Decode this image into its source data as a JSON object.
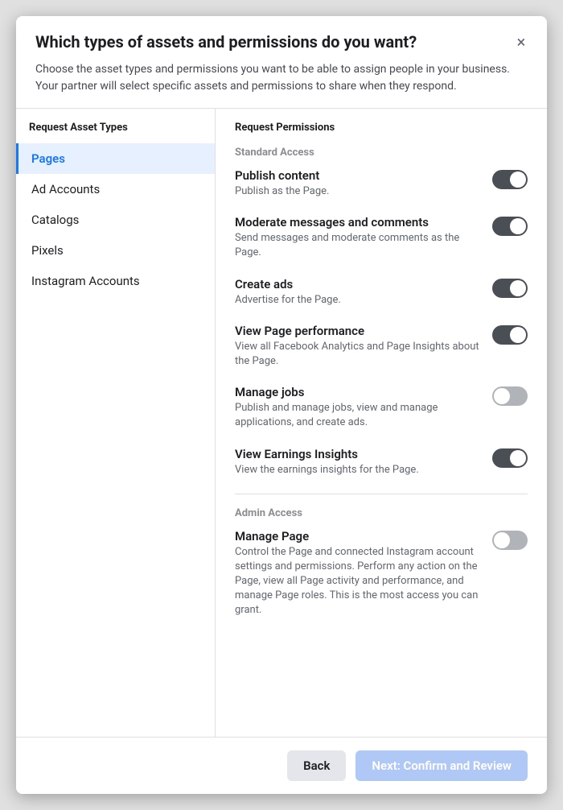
{
  "modal": {
    "title": "Which types of assets and permissions do you want?",
    "description": "Choose the asset types and permissions you want to be able to assign people in your business. Your partner will select specific assets and permissions to share when they respond.",
    "close_label": "×"
  },
  "left_panel": {
    "title": "Request Asset Types",
    "nav_items": [
      {
        "id": "pages",
        "label": "Pages",
        "active": true
      },
      {
        "id": "ad-accounts",
        "label": "Ad Accounts",
        "active": false
      },
      {
        "id": "catalogs",
        "label": "Catalogs",
        "active": false
      },
      {
        "id": "pixels",
        "label": "Pixels",
        "active": false
      },
      {
        "id": "instagram-accounts",
        "label": "Instagram Accounts",
        "active": false
      }
    ]
  },
  "right_panel": {
    "title": "Request Permissions",
    "sections": [
      {
        "label": "Standard Access",
        "permissions": [
          {
            "name": "Publish content",
            "desc": "Publish as the Page.",
            "toggle": "on"
          },
          {
            "name": "Moderate messages and comments",
            "desc": "Send messages and moderate comments as the Page.",
            "toggle": "on"
          },
          {
            "name": "Create ads",
            "desc": "Advertise for the Page.",
            "toggle": "on"
          },
          {
            "name": "View Page performance",
            "desc": "View all Facebook Analytics and Page Insights about the Page.",
            "toggle": "on"
          },
          {
            "name": "Manage jobs",
            "desc": "Publish and manage jobs, view and manage applications, and create ads.",
            "toggle": "off"
          },
          {
            "name": "View Earnings Insights",
            "desc": "View the earnings insights for the Page.",
            "toggle": "on"
          }
        ]
      },
      {
        "label": "Admin Access",
        "permissions": [
          {
            "name": "Manage Page",
            "desc": "Control the Page and connected Instagram account settings and permissions. Perform any action on the Page, view all Page activity and performance, and manage Page roles. This is the most access you can grant.",
            "toggle": "off"
          }
        ]
      }
    ]
  },
  "footer": {
    "back_label": "Back",
    "next_label": "Next: Confirm and Review"
  }
}
